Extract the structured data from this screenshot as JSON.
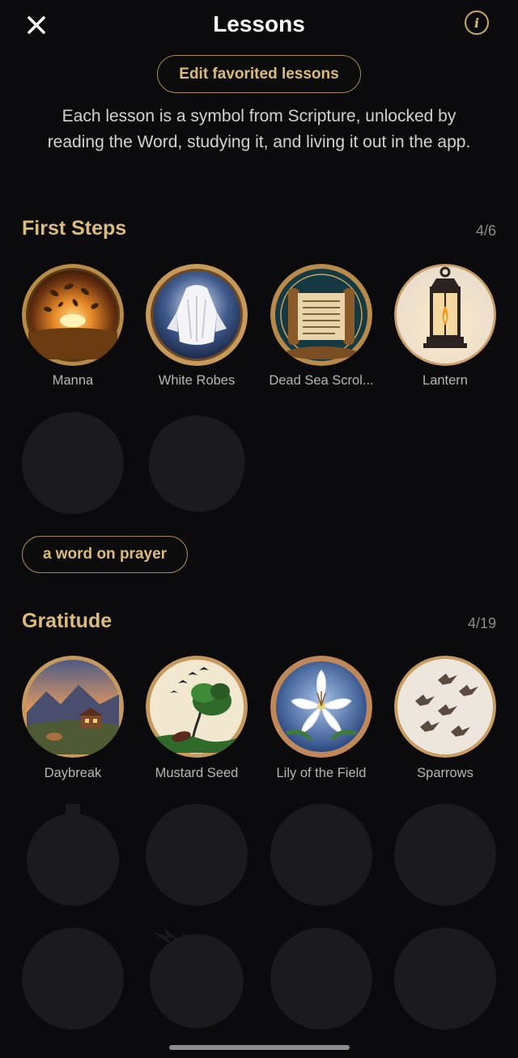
{
  "header": {
    "title": "Lessons",
    "close_icon": "close-icon",
    "info_icon": "info-icon",
    "info_glyph": "i"
  },
  "edit_button_label": "Edit favorited lessons",
  "description": "Each lesson is a symbol from Scripture, unlocked by reading the Word, studying it, and living it out in the app.",
  "sections": [
    {
      "title": "First Steps",
      "count": "4/6",
      "unlocked": [
        {
          "label": "Manna",
          "icon": "manna-icon"
        },
        {
          "label": "White Robes",
          "icon": "white-robes-icon"
        },
        {
          "label": "Dead Sea Scrol...",
          "icon": "scroll-icon"
        },
        {
          "label": "Lantern",
          "icon": "lantern-icon"
        }
      ],
      "locked_count": 2,
      "extra_button": "a word on prayer"
    },
    {
      "title": "Gratitude",
      "count": "4/19",
      "unlocked": [
        {
          "label": "Daybreak",
          "icon": "daybreak-icon"
        },
        {
          "label": "Mustard Seed",
          "icon": "mustard-seed-icon"
        },
        {
          "label": "Lily of the Field",
          "icon": "lily-icon"
        },
        {
          "label": "Sparrows",
          "icon": "sparrows-icon"
        }
      ],
      "locked_count": 8
    }
  ],
  "colors": {
    "background": "#0b0b0e",
    "accent_gold": "#dcbc7d",
    "locked_badge": "#1b1b1f"
  }
}
